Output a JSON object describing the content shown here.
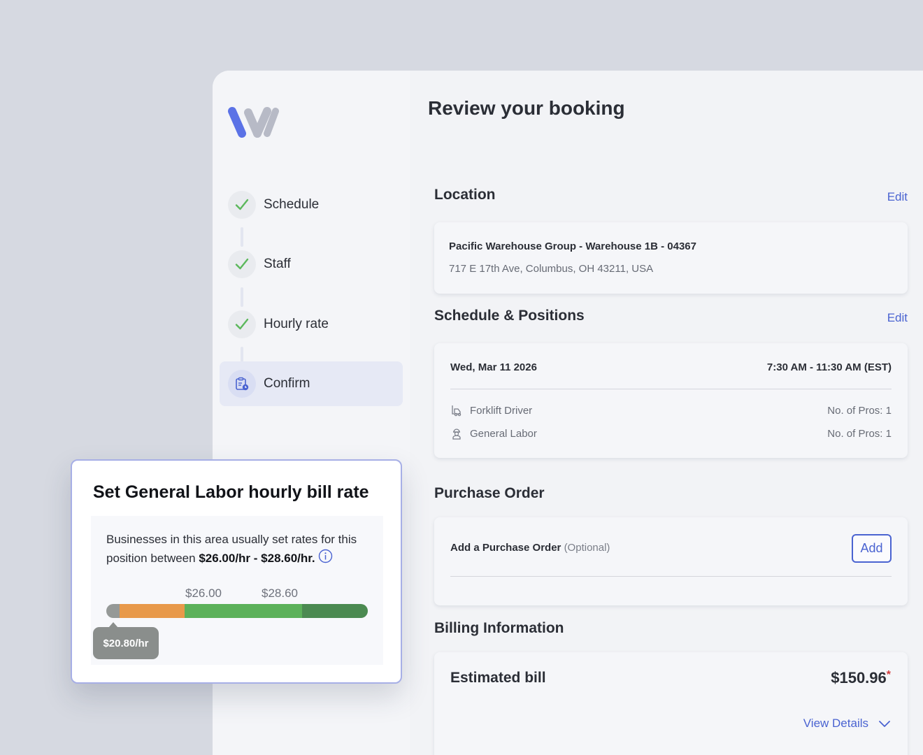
{
  "sidebar": {
    "steps": [
      {
        "label": "Schedule",
        "status": "complete"
      },
      {
        "label": "Staff",
        "status": "complete"
      },
      {
        "label": "Hourly rate",
        "status": "complete"
      },
      {
        "label": "Confirm",
        "status": "active"
      }
    ]
  },
  "main": {
    "title": "Review your booking",
    "location": {
      "heading": "Location",
      "edit_label": "Edit",
      "name": "Pacific Warehouse Group - Warehouse 1B - 04367",
      "address": "717 E 17th Ave, Columbus, OH 43211, USA"
    },
    "schedule": {
      "heading": "Schedule & Positions",
      "edit_label": "Edit",
      "date": "Wed, Mar 11 2026",
      "time": "7:30 AM - 11:30 AM (EST)",
      "positions": [
        {
          "name": "Forklift Driver",
          "count": "No. of Pros: 1",
          "icon": "forklift-icon"
        },
        {
          "name": "General Labor",
          "count": "No. of Pros: 1",
          "icon": "worker-icon"
        }
      ]
    },
    "purchase_order": {
      "heading": "Purchase Order",
      "label": "Add a Purchase Order",
      "optional": "(Optional)",
      "add_label": "Add"
    },
    "billing": {
      "heading": "Billing Information",
      "estimated_label": "Estimated bill",
      "amount": "$150.96",
      "asterisk": "*",
      "view_details": "View Details"
    }
  },
  "popup": {
    "title": "Set General Labor hourly bill rate",
    "text_before": "Businesses in this area usually set rates for this position between ",
    "range_text": "$26.00/hr - $28.60/hr.",
    "tick_low": "$26.00",
    "tick_high": "$28.60",
    "current_rate": "$20.80/hr",
    "bar_segments": [
      {
        "name": "below-range",
        "fraction": 0.05,
        "color": "#959997"
      },
      {
        "name": "low",
        "fraction": 0.25,
        "color": "#e8994a"
      },
      {
        "name": "typical",
        "fraction": 0.45,
        "color": "#5cb15a"
      },
      {
        "name": "high",
        "fraction": 0.25,
        "color": "#4b8a51"
      }
    ]
  },
  "colors": {
    "accent": "#4a63d1",
    "check": "#5cb85c",
    "logo_blue": "#5b72e6",
    "logo_grey": "#b7bac6"
  }
}
